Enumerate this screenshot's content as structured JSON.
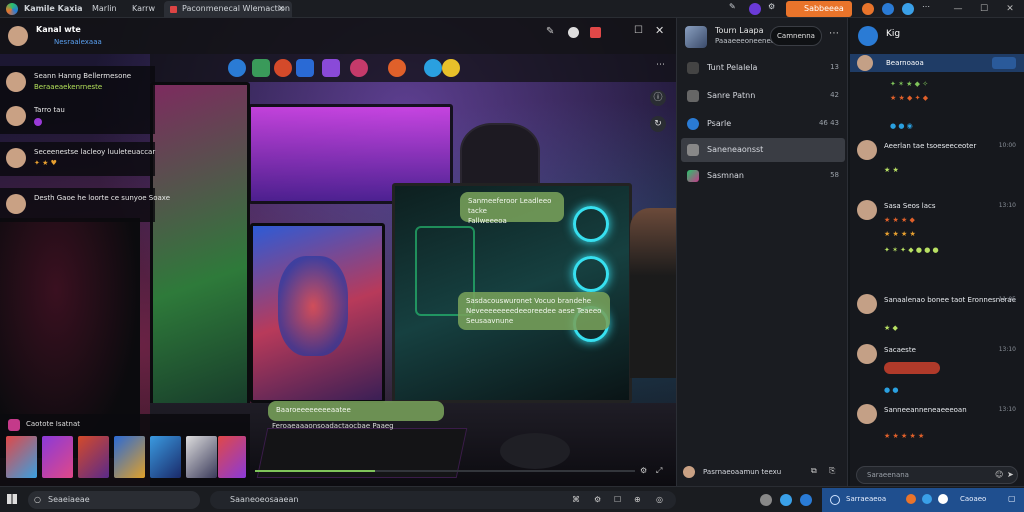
{
  "titlebar": {
    "app_name": "Kamile Kaxia",
    "menu_1": "Marlin",
    "menu_2": "Karrw",
    "active_tab": "Paconmenecal Wlemaction",
    "accent_button": "Sabbeeea",
    "colors": {
      "accent_orange": "#e9742b",
      "brand_blue": "#2a7bd5"
    }
  },
  "stream": {
    "streamer_name": "Kanal wte",
    "streamer_sub": "Nesraalexaaa",
    "overlay_messages": [
      {
        "name": "Seann Hanng Bellermesone",
        "text": "Beraaeaekenrneste"
      },
      {
        "name": "Tarro tau",
        "text": ""
      },
      {
        "name": "Seceenestse lacleoy luuleteuaccar",
        "text": ""
      },
      {
        "name": "Desth Gaoe he loorte ce sunyoe Soaxe",
        "text": ""
      }
    ],
    "bubbles": [
      "Sanmeeferoor Leadleeo tacke\nFallweeeoa",
      "Sasdacouswuronet Vocuo brandehe\nNeveeeeeeeedeeoreedee aese Teaeeo\nSeusaavnune",
      "Baaroeeeeeeeeaatee"
    ],
    "caption": "Feroaeaaaonsoadactaocbae Paaeg",
    "thumb_title": "Caotote Isatnat"
  },
  "conversations": {
    "search_label": "Camnenna",
    "items": [
      {
        "label": "Tunt Pelalela",
        "meta": "13"
      },
      {
        "label": "Sanre Patnn",
        "meta": "42"
      },
      {
        "label": "Psarle",
        "meta": "46 43"
      },
      {
        "label": "Saneneaonsst",
        "meta": ""
      },
      {
        "label": "Sasmnan",
        "meta": "58"
      }
    ],
    "footer_label": "Pasrnaeoaamun teexu"
  },
  "header": {
    "panel_title": "Tourn Laapa",
    "panel_sub": "Paaaeeeoneeneeo"
  },
  "chat": {
    "title": "Kig",
    "top_user": "Bearnoaoa",
    "messages": [
      {
        "name": "Aeerlan tae tsoeseeceoter",
        "time": "10:00"
      },
      {
        "name": "Sasa Seos lacs",
        "time": "13:10"
      },
      {
        "name": "Sanaalenao bonee taot Eronnesnerae",
        "time": "11:05"
      },
      {
        "name": "Sacaeste",
        "time": "13:10"
      },
      {
        "name": "Sanneeanneneaeeeoan",
        "time": "13:10"
      }
    ],
    "input_placeholder": "Saraeenana"
  },
  "taskbar": {
    "search_label": "Seaeiaeae",
    "mid_label": "Saaneoeosaaean",
    "tray_label": "Sarraeaeoa",
    "tray_time": "Caoaeo"
  }
}
